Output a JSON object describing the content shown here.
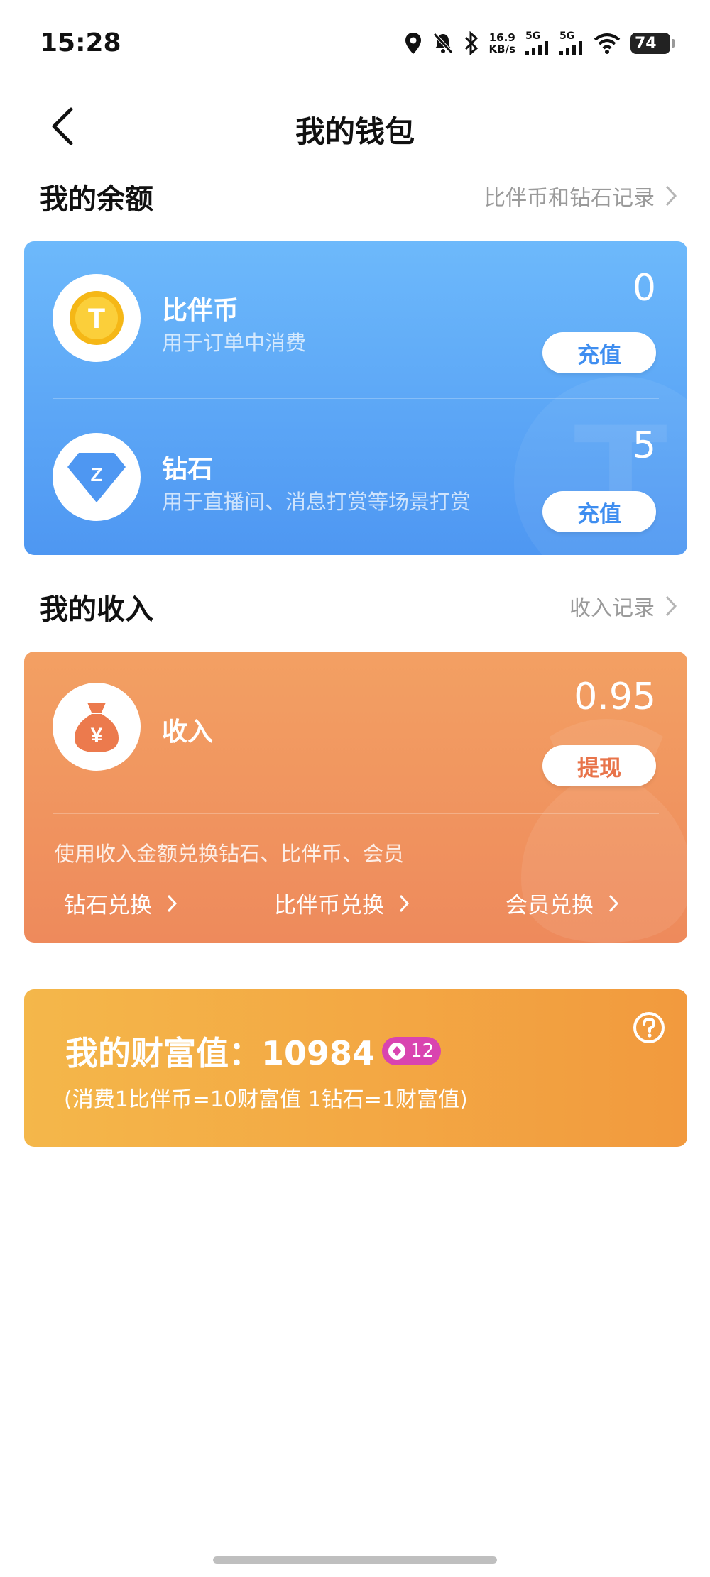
{
  "status_bar": {
    "time": "15:28",
    "net_speed_value": "16.9",
    "net_speed_unit": "KB/s",
    "sim1": "5G",
    "sim2": "5G",
    "battery": "74"
  },
  "header": {
    "title": "我的钱包"
  },
  "balance": {
    "section_title": "我的余额",
    "record_link": "比伴币和钻石记录",
    "items": [
      {
        "name": "比伴币",
        "desc": "用于订单中消费",
        "amount": "0",
        "action": "充值",
        "icon": "coin-icon",
        "icon_glyph": "T"
      },
      {
        "name": "钻石",
        "desc": "用于直播间、消息打赏等场景打赏",
        "amount": "5",
        "action": "充值",
        "icon": "diamond-icon",
        "icon_glyph": "Z"
      }
    ]
  },
  "income": {
    "section_title": "我的收入",
    "record_link": "收入记录",
    "name": "收入",
    "amount": "0.95",
    "action": "提现",
    "icon": "money-bag-icon",
    "icon_glyph": "¥",
    "hint": "使用收入金额兑换钻石、比伴币、会员",
    "exchanges": [
      "钻石兑换",
      "比伴币兑换",
      "会员兑换"
    ]
  },
  "wealth": {
    "title": "我的财富值：10984",
    "level": "12",
    "note": "(消费1比伴币=10财富值 1钻石=1财富值)",
    "help_icon": "question-circle-icon"
  },
  "colors": {
    "blue_card": "#5aa6f6",
    "orange_card": "#f0935f",
    "gold_card": "#f3a944",
    "blue_text": "#3f8ef0",
    "orange_text": "#e8744a",
    "level_badge": "#d944b0"
  }
}
